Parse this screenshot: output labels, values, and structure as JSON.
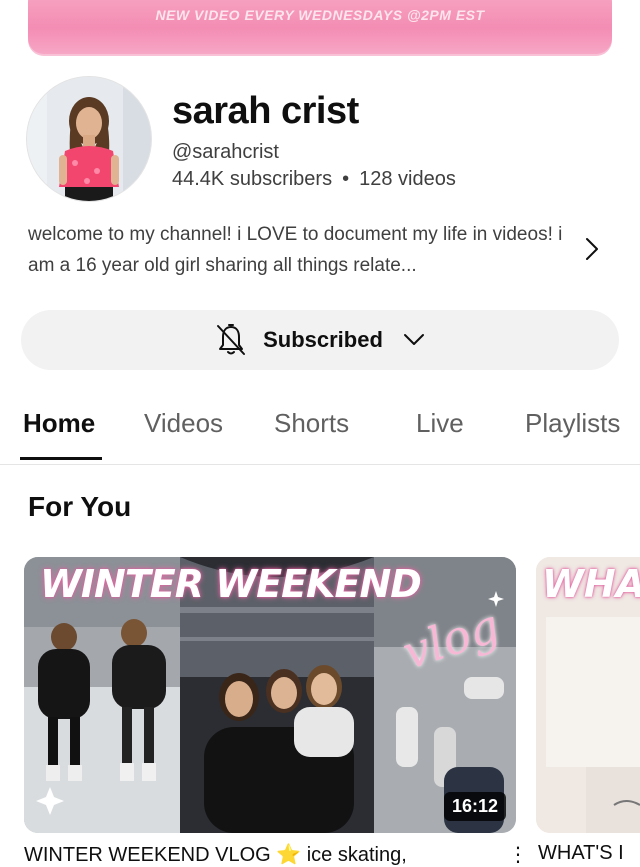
{
  "banner": {
    "text": "NEW VIDEO EVERY WEDNESDAYS @2PM EST"
  },
  "channel": {
    "name": "sarah crist",
    "handle": "@sarahcrist",
    "subscribers": "44.4K subscribers",
    "separator": "•",
    "videos": "128 videos",
    "description": "welcome to my channel! i LOVE to document my life in videos! i am a 16 year old girl sharing all things relate..."
  },
  "subscribe_button": {
    "label": "Subscribed"
  },
  "tabs": [
    {
      "label": "Home",
      "active": true
    },
    {
      "label": "Videos",
      "active": false
    },
    {
      "label": "Shorts",
      "active": false
    },
    {
      "label": "Live",
      "active": false
    },
    {
      "label": "Playlists",
      "active": false
    }
  ],
  "section": {
    "title": "For You"
  },
  "videos": [
    {
      "thumb_title": "WINTER WEEKEND",
      "thumb_script": "vlog",
      "duration": "16:12",
      "caption": "WINTER WEEKEND VLOG ⭐ ice skating,"
    },
    {
      "thumb_title": "WHA",
      "caption": "WHAT'S I"
    }
  ],
  "icons": {
    "bell": "bell-off-icon",
    "chevron_down": "chevron-down-icon",
    "chevron_right": "chevron-right-icon",
    "more": "more-vert-icon"
  },
  "colors": {
    "banner_pink": "#f48db3",
    "button_bg": "#f2f2f2",
    "text_primary": "#0f0f0f",
    "text_secondary": "#606060"
  }
}
